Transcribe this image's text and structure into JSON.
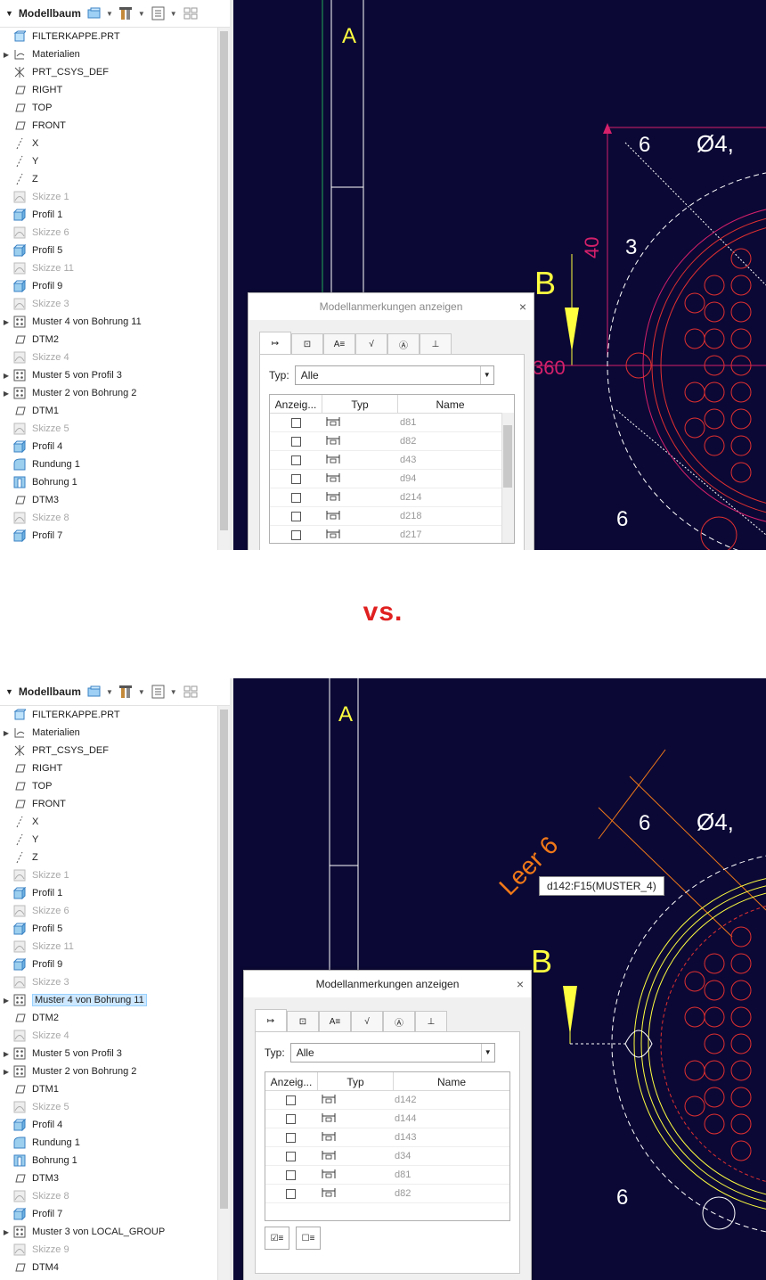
{
  "tree_title": "Modellbaum",
  "vs_label": "vs.",
  "panel1": {
    "items": [
      {
        "label": "FILTERKAPPE.PRT",
        "icon": "part-icon",
        "dim": false,
        "exp": false
      },
      {
        "label": "Materialien",
        "icon": "materials-icon",
        "dim": false,
        "exp": true
      },
      {
        "label": "PRT_CSYS_DEF",
        "icon": "csys-icon",
        "dim": false,
        "exp": false
      },
      {
        "label": "RIGHT",
        "icon": "plane-icon",
        "dim": false,
        "exp": false
      },
      {
        "label": "TOP",
        "icon": "plane-icon",
        "dim": false,
        "exp": false
      },
      {
        "label": "FRONT",
        "icon": "plane-icon",
        "dim": false,
        "exp": false
      },
      {
        "label": "X",
        "icon": "axis-icon",
        "dim": false,
        "exp": false
      },
      {
        "label": "Y",
        "icon": "axis-icon",
        "dim": false,
        "exp": false
      },
      {
        "label": "Z",
        "icon": "axis-icon",
        "dim": false,
        "exp": false
      },
      {
        "label": "Skizze 1",
        "icon": "sketch-icon",
        "dim": true,
        "exp": false
      },
      {
        "label": "Profil 1",
        "icon": "extrude-icon",
        "dim": false,
        "exp": false
      },
      {
        "label": "Skizze 6",
        "icon": "sketch-icon",
        "dim": true,
        "exp": false
      },
      {
        "label": "Profil 5",
        "icon": "extrude-icon",
        "dim": false,
        "exp": false
      },
      {
        "label": "Skizze 11",
        "icon": "sketch-icon",
        "dim": true,
        "exp": false
      },
      {
        "label": "Profil 9",
        "icon": "extrude-icon",
        "dim": false,
        "exp": false
      },
      {
        "label": "Skizze 3",
        "icon": "sketch-icon",
        "dim": true,
        "exp": false
      },
      {
        "label": "Muster 4 von Bohrung 11",
        "icon": "pattern-icon",
        "dim": false,
        "exp": true
      },
      {
        "label": "DTM2",
        "icon": "plane-icon",
        "dim": false,
        "exp": false
      },
      {
        "label": "Skizze 4",
        "icon": "sketch-icon",
        "dim": true,
        "exp": false
      },
      {
        "label": "Muster 5 von Profil 3",
        "icon": "pattern-icon",
        "dim": false,
        "exp": true
      },
      {
        "label": "Muster 2 von Bohrung 2",
        "icon": "pattern-icon",
        "dim": false,
        "exp": true
      },
      {
        "label": "DTM1",
        "icon": "plane-icon",
        "dim": false,
        "exp": false
      },
      {
        "label": "Skizze 5",
        "icon": "sketch-icon",
        "dim": true,
        "exp": false
      },
      {
        "label": "Profil 4",
        "icon": "extrude-icon",
        "dim": false,
        "exp": false
      },
      {
        "label": "Rundung 1",
        "icon": "round-icon",
        "dim": false,
        "exp": false
      },
      {
        "label": "Bohrung 1",
        "icon": "hole-icon",
        "dim": false,
        "exp": false
      },
      {
        "label": "DTM3",
        "icon": "plane-icon",
        "dim": false,
        "exp": false
      },
      {
        "label": "Skizze 8",
        "icon": "sketch-icon",
        "dim": true,
        "exp": false
      },
      {
        "label": "Profil 7",
        "icon": "extrude-icon",
        "dim": false,
        "exp": false
      }
    ],
    "dialog": {
      "title": "Modellanmerkungen anzeigen",
      "typ_label": "Typ:",
      "typ_value": "Alle",
      "col_show": "Anzeig...",
      "col_type": "Typ",
      "col_name": "Name",
      "rows": [
        "d81",
        "d82",
        "d43",
        "d94",
        "d214",
        "d218",
        "d217"
      ]
    }
  },
  "panel2": {
    "items": [
      {
        "label": "FILTERKAPPE.PRT",
        "icon": "part-icon",
        "dim": false,
        "exp": false
      },
      {
        "label": "Materialien",
        "icon": "materials-icon",
        "dim": false,
        "exp": true
      },
      {
        "label": "PRT_CSYS_DEF",
        "icon": "csys-icon",
        "dim": false,
        "exp": false
      },
      {
        "label": "RIGHT",
        "icon": "plane-icon",
        "dim": false,
        "exp": false
      },
      {
        "label": "TOP",
        "icon": "plane-icon",
        "dim": false,
        "exp": false
      },
      {
        "label": "FRONT",
        "icon": "plane-icon",
        "dim": false,
        "exp": false
      },
      {
        "label": "X",
        "icon": "axis-icon",
        "dim": false,
        "exp": false
      },
      {
        "label": "Y",
        "icon": "axis-icon",
        "dim": false,
        "exp": false
      },
      {
        "label": "Z",
        "icon": "axis-icon",
        "dim": false,
        "exp": false
      },
      {
        "label": "Skizze 1",
        "icon": "sketch-icon",
        "dim": true,
        "exp": false
      },
      {
        "label": "Profil 1",
        "icon": "extrude-icon",
        "dim": false,
        "exp": false
      },
      {
        "label": "Skizze 6",
        "icon": "sketch-icon",
        "dim": true,
        "exp": false
      },
      {
        "label": "Profil 5",
        "icon": "extrude-icon",
        "dim": false,
        "exp": false
      },
      {
        "label": "Skizze 11",
        "icon": "sketch-icon",
        "dim": true,
        "exp": false
      },
      {
        "label": "Profil 9",
        "icon": "extrude-icon",
        "dim": false,
        "exp": false
      },
      {
        "label": "Skizze 3",
        "icon": "sketch-icon",
        "dim": true,
        "exp": false
      },
      {
        "label": "Muster 4 von Bohrung 11",
        "icon": "pattern-icon",
        "dim": false,
        "exp": true,
        "selected": true
      },
      {
        "label": "DTM2",
        "icon": "plane-icon",
        "dim": false,
        "exp": false
      },
      {
        "label": "Skizze 4",
        "icon": "sketch-icon",
        "dim": true,
        "exp": false
      },
      {
        "label": "Muster 5 von Profil 3",
        "icon": "pattern-icon",
        "dim": false,
        "exp": true
      },
      {
        "label": "Muster 2 von Bohrung 2",
        "icon": "pattern-icon",
        "dim": false,
        "exp": true
      },
      {
        "label": "DTM1",
        "icon": "plane-icon",
        "dim": false,
        "exp": false
      },
      {
        "label": "Skizze 5",
        "icon": "sketch-icon",
        "dim": true,
        "exp": false
      },
      {
        "label": "Profil 4",
        "icon": "extrude-icon",
        "dim": false,
        "exp": false
      },
      {
        "label": "Rundung 1",
        "icon": "round-icon",
        "dim": false,
        "exp": false
      },
      {
        "label": "Bohrung 1",
        "icon": "hole-icon",
        "dim": false,
        "exp": false
      },
      {
        "label": "DTM3",
        "icon": "plane-icon",
        "dim": false,
        "exp": false
      },
      {
        "label": "Skizze 8",
        "icon": "sketch-icon",
        "dim": true,
        "exp": false
      },
      {
        "label": "Profil 7",
        "icon": "extrude-icon",
        "dim": false,
        "exp": false
      },
      {
        "label": "Muster 3 von LOCAL_GROUP",
        "icon": "pattern-icon",
        "dim": false,
        "exp": true
      },
      {
        "label": "Skizze 9",
        "icon": "sketch-icon",
        "dim": true,
        "exp": false
      },
      {
        "label": "DTM4",
        "icon": "plane-icon",
        "dim": false,
        "exp": false
      }
    ],
    "dialog": {
      "title": "Modellanmerkungen anzeigen",
      "typ_label": "Typ:",
      "typ_value": "Alle",
      "col_show": "Anzeig...",
      "col_type": "Typ",
      "col_name": "Name",
      "rows": [
        "d142",
        "d144",
        "d143",
        "d34",
        "d81",
        "d82"
      ]
    },
    "tooltip": "d142:F15(MUSTER_4)",
    "leader_text": "Leer 6"
  },
  "cad_labels": {
    "a": "A",
    "b": "B",
    "dim6": "6",
    "dim40": "40",
    "dim3": "3",
    "dim360": "360",
    "dia": "Ø4,"
  },
  "colors": {
    "canvas": "#0b0835",
    "dim_magenta": "#d4206a",
    "yellow": "#ffff40",
    "orange": "#f07818",
    "red": "#e02020"
  }
}
